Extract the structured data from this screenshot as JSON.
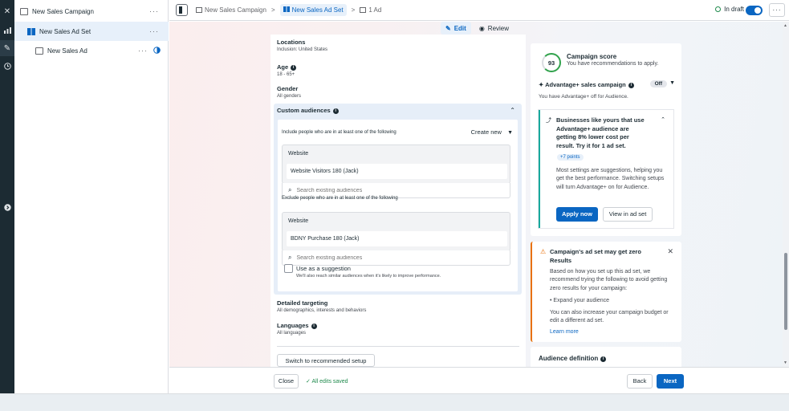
{
  "tree": {
    "campaign": "New Sales Campaign",
    "adset": "New Sales Ad Set",
    "ad": "New Sales Ad",
    "dots": "···"
  },
  "topbar": {
    "crumb_campaign": "New Sales Campaign",
    "crumb_adset": "New Sales Ad Set",
    "crumb_ad": "1 Ad",
    "sep": ">",
    "status": "In draft",
    "more": "···"
  },
  "modes": {
    "edit": "Edit",
    "review": "Review"
  },
  "form": {
    "locations_title": "Locations",
    "locations_sub": "Inclusion: United States",
    "age_title": "Age",
    "age_sub": "18 - 65+",
    "gender_title": "Gender",
    "gender_sub": "All genders",
    "custom_audiences_title": "Custom audiences",
    "include_text": "Include people who are in at least one of the following",
    "create_new": "Create new",
    "include_block_title": "Website",
    "include_block_value": "Website Visitors 180 (Jack)",
    "search_placeholder": "Search existing audiences",
    "exclude_text": "Exclude people who are in at least one of the following",
    "exclude_block_title": "Website",
    "exclude_block_value": "BDNY Purchase 180 (Jack)",
    "suggestion_title": "Use as a suggestion",
    "suggestion_sub": "We'll also reach similar audiences when it's likely to improve performance.",
    "detailed_title": "Detailed targeting",
    "detailed_sub": "All demographics, interests and behaviors",
    "languages_title": "Languages",
    "languages_sub": "All languages",
    "switch_button": "Switch to recommended setup"
  },
  "right": {
    "score_value": "93",
    "score_title": "Campaign score",
    "score_sub": "You have recommendations to apply.",
    "advantage_title": "Advantage+ sales campaign",
    "advantage_state": "Off",
    "advantage_sub": "You have Advantage+ off for Audience.",
    "tip_title": "Businesses like yours that use Advantage+ audience are getting 8% lower cost per result. Try it for 1 ad set.",
    "tip_points": "+7 points",
    "tip_body": "Most settings are suggestions, helping you get the best performance. Switching setups will turn Advantage+ on for Audience.",
    "apply_now": "Apply now",
    "view_in_ad_set": "View in ad set",
    "warn_title": "Campaign's ad set may get zero Results",
    "warn_body": "Based on how you set up this ad set, we recommend trying the following to avoid getting zero results for your campaign:",
    "warn_bullet": "Expand your audience",
    "warn_body2": "You can also increase your campaign budget or edit a different ad set.",
    "learn_more": "Learn more",
    "audience_definition": "Audience definition"
  },
  "footer": {
    "close": "Close",
    "saved": "All edits saved",
    "back": "Back",
    "next": "Next"
  },
  "colors": {
    "accent": "#0a66c2",
    "success": "#1f8a4c",
    "warning": "#e8710a",
    "teal": "#18a99d",
    "rail": "#1c2b33"
  }
}
